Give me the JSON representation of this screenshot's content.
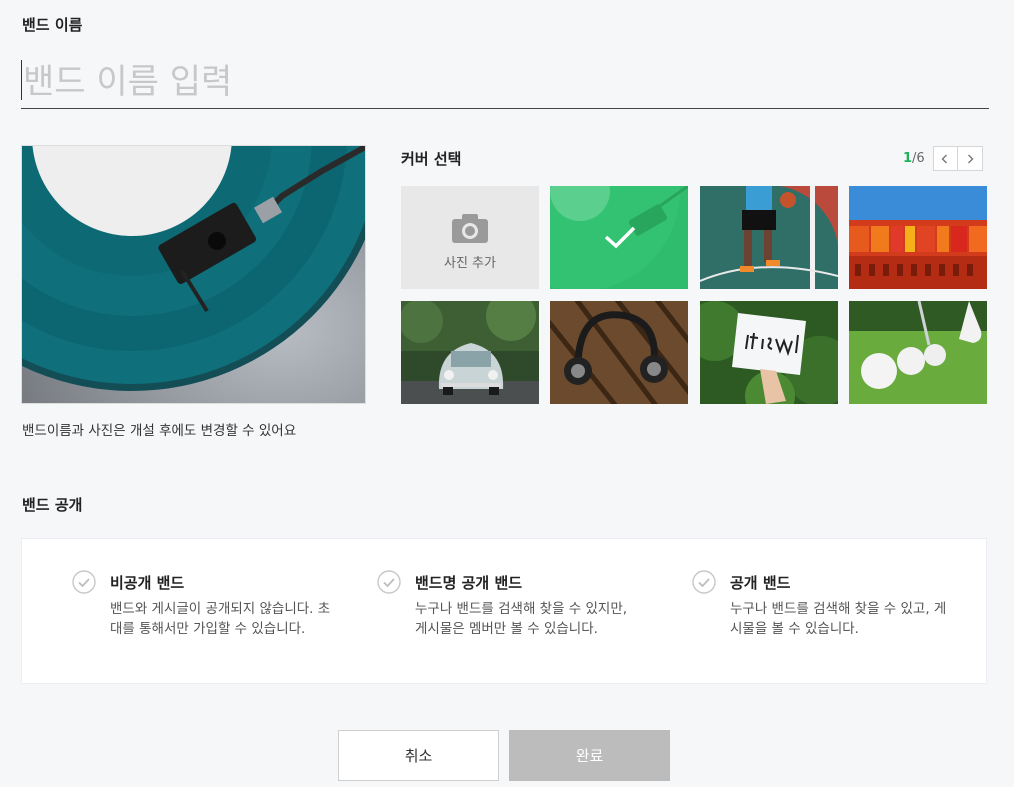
{
  "name_section": {
    "label": "밴드 이름",
    "placeholder": "밴드 이름 입력",
    "value": ""
  },
  "preview": {
    "note": "밴드이름과 사진은 개설 후에도 변경할 수 있어요"
  },
  "cover": {
    "title": "커버 선택",
    "page_current": "1",
    "page_total": "/6",
    "add_photo_label": "사진 추가",
    "tiles": [
      {
        "name": "vinyl-teal",
        "selected": true
      },
      {
        "name": "basketball-court"
      },
      {
        "name": "colorful-building"
      },
      {
        "name": "vintage-car"
      },
      {
        "name": "headphones"
      },
      {
        "name": "it-is-well-sign"
      },
      {
        "name": "golf-balls"
      }
    ],
    "accent_color": "#1eb25a"
  },
  "privacy": {
    "label": "밴드 공개",
    "options": [
      {
        "title": "비공개 밴드",
        "desc": "밴드와 게시글이 공개되지 않습니다. 초대를 통해서만 가입할 수 있습니다."
      },
      {
        "title": "밴드명 공개 밴드",
        "desc": "누구나 밴드를 검색해 찾을 수 있지만, 게시물은 멤버만 볼 수 있습니다."
      },
      {
        "title": "공개 밴드",
        "desc": "누구나 밴드를 검색해 찾을 수 있고, 게시물을 볼 수 있습니다."
      }
    ]
  },
  "actions": {
    "cancel_label": "취소",
    "done_label": "완료"
  }
}
